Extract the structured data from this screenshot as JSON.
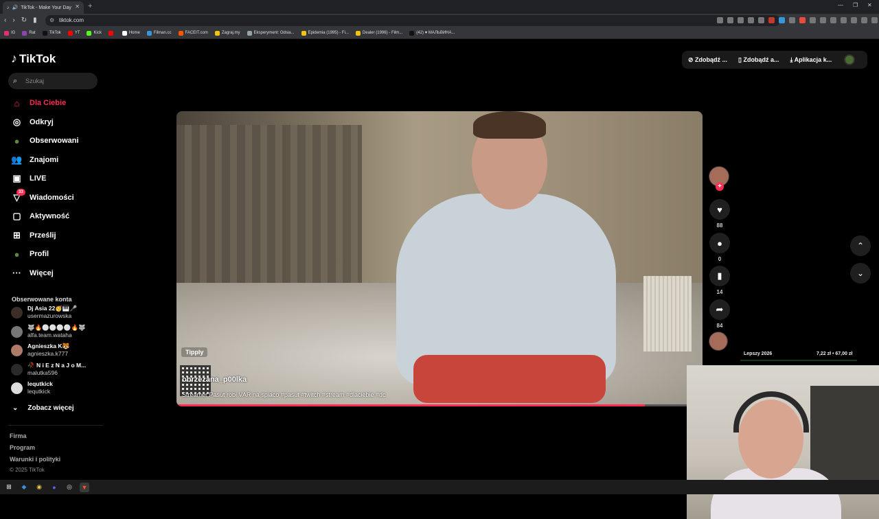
{
  "browser": {
    "tab_title": "TikTok - Make Your Day",
    "url": "tiktok.com",
    "bookmarks": [
      {
        "label": "IG",
        "color": "#e1306c"
      },
      {
        "label": "Rat",
        "color": "#8e44ad"
      },
      {
        "label": "TikTok",
        "color": "#111111"
      },
      {
        "label": "YT",
        "color": "#ff0000"
      },
      {
        "label": "Kick",
        "color": "#53fc18"
      },
      {
        "label": "",
        "color": "#ff0000"
      },
      {
        "label": "Home",
        "color": "#ffffff"
      },
      {
        "label": "Filman.cc",
        "color": "#3498db"
      },
      {
        "label": "FACEIT.com",
        "color": "#ff5500"
      },
      {
        "label": "Zagraj.my",
        "color": "#f1c40f"
      },
      {
        "label": "Eksperyment: Odsia...",
        "color": "#95a5a6"
      },
      {
        "label": "Epidemia (1995) - Fi...",
        "color": "#f1c40f"
      },
      {
        "label": "Dealer (1996) - Film...",
        "color": "#f1c40f"
      },
      {
        "label": "(42) ♥ МАЛЬВИНА...",
        "color": "#111111"
      }
    ]
  },
  "sidebar": {
    "logo": "TikTok",
    "search_placeholder": "Szukaj",
    "nav": [
      {
        "label": "Dla Ciebie",
        "icon": "home-icon"
      },
      {
        "label": "Odkryj",
        "icon": "compass-icon"
      },
      {
        "label": "Obserwowani",
        "icon": "avatar-icon"
      },
      {
        "label": "Znajomi",
        "icon": "friends-icon"
      },
      {
        "label": "LIVE",
        "icon": "live-icon"
      },
      {
        "label": "Wiadomości",
        "icon": "messages-icon",
        "badge": "33"
      },
      {
        "label": "Aktywność",
        "icon": "activity-icon"
      },
      {
        "label": "Prześlij",
        "icon": "upload-icon"
      },
      {
        "label": "Profil",
        "icon": "profile-icon"
      },
      {
        "label": "Więcej",
        "icon": "more-icon"
      }
    ],
    "followed_title": "Obserwowane konta",
    "followed": [
      {
        "name": "Dj Asia 22🥳🎹🎤",
        "handle": "usermazurowska"
      },
      {
        "name": "🐺🔥⚪⚪⚪⚪🔥🐺",
        "handle": "alfa.team.wataha"
      },
      {
        "name": "Agnieszka K🐯",
        "handle": "agnieszka.k777"
      },
      {
        "name": "🥀 N i E z N a J o M...",
        "handle": "malutka596"
      },
      {
        "name": "lequtkick",
        "handle": "lequtkick"
      }
    ],
    "see_more": "Zobacz więcej",
    "footer": [
      "Firma",
      "Program",
      "Warunki i polityki"
    ],
    "copyright": "© 2025 TikTok"
  },
  "top_buttons": [
    "Zdobądź ...",
    "Zdobądź a...",
    "Aplikacja k..."
  ],
  "video": {
    "overlay_label": "Tipply",
    "author": "obrzezana_p00lka",
    "description": "Streamer Pasut robi VAR na spiaco #pasut #twitch #stream #dlaciebie #dc",
    "progress": 0.89
  },
  "actions": {
    "likes": "88",
    "comments": "0",
    "saves": "14",
    "shares": "84"
  },
  "stream_overlay": {
    "goal_label": "Lepszy 2026",
    "goal_value": "7,22 zł • 67,00 zł"
  }
}
